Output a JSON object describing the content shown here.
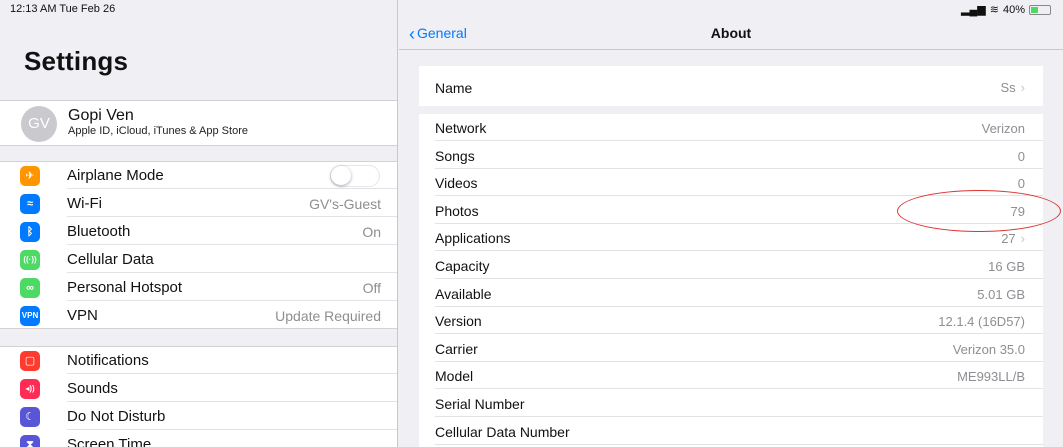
{
  "status": {
    "time": "12:13 AM  Tue Feb 26",
    "battery": "40%",
    "battery_level": 0.4
  },
  "sidebar": {
    "title": "Settings",
    "profile": {
      "initials": "GV",
      "name": "Gopi Ven",
      "subtitle": "Apple ID, iCloud, iTunes & App Store"
    },
    "group1": [
      {
        "label": "Airplane Mode",
        "value": "",
        "icon": "airplane-icon",
        "color": "#ff9500",
        "glyph": "✈",
        "toggle": true
      },
      {
        "label": "Wi-Fi",
        "value": "GV's-Guest",
        "icon": "wifi-icon",
        "color": "#007aff",
        "glyph": "≈"
      },
      {
        "label": "Bluetooth",
        "value": "On",
        "icon": "bluetooth-icon",
        "color": "#007aff",
        "glyph": "ᛒ"
      },
      {
        "label": "Cellular Data",
        "value": "",
        "icon": "cellular-icon",
        "color": "#4cd964",
        "glyph": "((·))"
      },
      {
        "label": "Personal Hotspot",
        "value": "Off",
        "icon": "hotspot-icon",
        "color": "#4cd964",
        "glyph": "∞"
      },
      {
        "label": "VPN",
        "value": "Update Required",
        "icon": "vpn-icon",
        "color": "#007aff",
        "glyph": "VPN"
      }
    ],
    "group2": [
      {
        "label": "Notifications",
        "icon": "notifications-icon",
        "color": "#ff3b30",
        "glyph": "▢"
      },
      {
        "label": "Sounds",
        "icon": "sounds-icon",
        "color": "#ff2d55",
        "glyph": "◂))"
      },
      {
        "label": "Do Not Disturb",
        "icon": "moon-icon",
        "color": "#5856d6",
        "glyph": "☾"
      },
      {
        "label": "Screen Time",
        "icon": "hourglass-icon",
        "color": "#5856d6",
        "glyph": "⧗"
      }
    ]
  },
  "detail": {
    "back_label": "General",
    "title": "About",
    "name_row": {
      "label": "Name",
      "value": "Ss"
    },
    "rows": [
      {
        "label": "Network",
        "value": "Verizon",
        "chevron": false
      },
      {
        "label": "Songs",
        "value": "0",
        "chevron": false
      },
      {
        "label": "Videos",
        "value": "0",
        "chevron": false
      },
      {
        "label": "Photos",
        "value": "79",
        "chevron": false
      },
      {
        "label": "Applications",
        "value": "27",
        "chevron": true
      },
      {
        "label": "Capacity",
        "value": "16 GB",
        "chevron": false
      },
      {
        "label": "Available",
        "value": "5.01 GB",
        "chevron": false
      },
      {
        "label": "Version",
        "value": "12.1.4 (16D57)",
        "chevron": false
      },
      {
        "label": "Carrier",
        "value": "Verizon 35.0",
        "chevron": false
      },
      {
        "label": "Model",
        "value": "ME993LL/B",
        "chevron": false
      },
      {
        "label": "Serial Number",
        "value": "",
        "chevron": false
      },
      {
        "label": "Cellular Data Number",
        "value": "",
        "chevron": false
      }
    ]
  }
}
